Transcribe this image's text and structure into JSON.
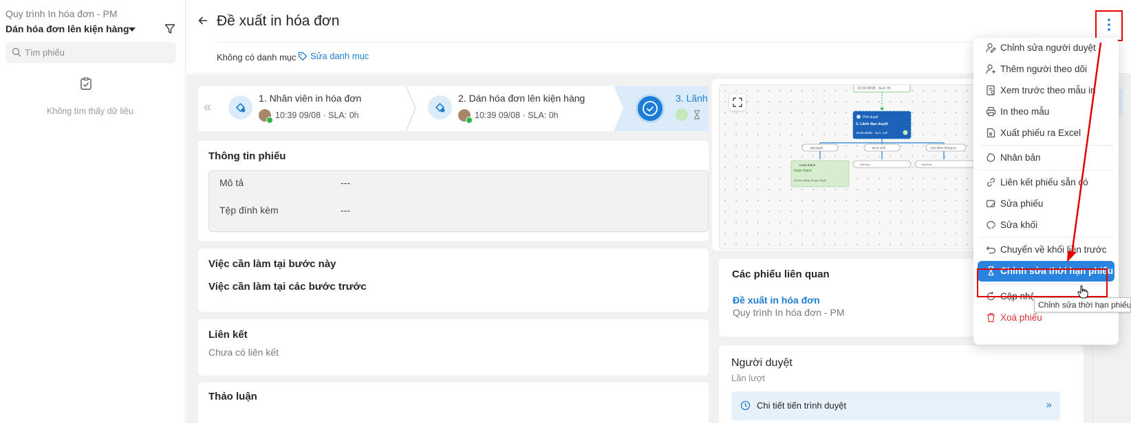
{
  "sidebar": {
    "breadcrumb": "Quy trình In hóa đơn - PM",
    "title": "Dán hóa đơn lên kiện hàng",
    "search_placeholder": "Tìm phiếu",
    "empty_text": "Không tìm thấy dữ liệu"
  },
  "header": {
    "title": "Đề xuất in hóa đơn",
    "category_none": "Không có danh mục",
    "category_edit": "Sửa danh mục"
  },
  "steps": [
    {
      "name": "1. Nhân viên in hóa đơn",
      "meta": "10:39 09/08 · SLA: 0h",
      "icon": "process-icon"
    },
    {
      "name": "2. Dán hóa đơn lên kiện hàng",
      "meta": "10:39 09/08 · SLA: 0h",
      "icon": "process-icon"
    },
    {
      "name": "3. Lãnh",
      "icon": "check-circle-icon"
    }
  ],
  "info": {
    "title": "Thông tin phiếu",
    "desc_label": "Mô tả",
    "desc_value": "---",
    "attach_label": "Tệp đính kèm",
    "attach_value": "---"
  },
  "todo": {
    "current": "Việc cần làm tại bước này",
    "previous": "Việc cần làm tại các bước trước"
  },
  "links": {
    "title": "Liên kết",
    "empty": "Chưa có liên kết"
  },
  "discussion": {
    "title": "Thảo luận"
  },
  "related": {
    "title": "Các phiếu liên quan",
    "link": "Đề xuất in hóa đơn",
    "sub": "Quy trình In hóa đơn - PM"
  },
  "approver": {
    "title": "Người duyệt",
    "mode": "Lần lượt",
    "progress_label": "Chi tiết tiến trình duyệt",
    "more": "»"
  },
  "menu": {
    "items": [
      {
        "label": "Chỉnh sửa người duyệt",
        "icon": "user-edit-icon"
      },
      {
        "label": "Thêm người theo dõi",
        "icon": "user-add-icon"
      },
      {
        "label": "Xem trước theo mẫu in",
        "icon": "preview-doc-icon"
      },
      {
        "label": "In theo mẫu",
        "icon": "printer-icon"
      },
      {
        "label": "Xuất phiếu ra Excel",
        "icon": "excel-export-icon"
      },
      {
        "label": "Nhân bản",
        "icon": "duplicate-icon"
      },
      {
        "label": "Liên kết phiếu sẵn có",
        "icon": "link-icon"
      },
      {
        "label": "Sửa phiếu",
        "icon": "edit-ticket-icon"
      },
      {
        "label": "Sửa khối",
        "icon": "edit-block-icon"
      },
      {
        "label": "Chuyển về khối liền trước",
        "icon": "undo-icon"
      },
      {
        "label": "Chỉnh sửa thời hạn phiếu",
        "icon": "hourglass-icon",
        "active": true
      },
      {
        "label": "Cập nhật",
        "icon": "refresh-icon"
      },
      {
        "label": "Xoá phiếu",
        "icon": "trash-icon",
        "danger": true
      }
    ],
    "tooltip": "Chỉnh sửa thời hạn phiếu"
  },
  "flow_thumbnail": {
    "box_top": "10:39 09/08 · SLA: 0h",
    "approve_title": "Phê duyệt",
    "approve_name": "3. Lãnh đạo duyệt",
    "approve_meta": "10:39 09/08 · SLA: 12h",
    "branch_ok": "Đã duyệt",
    "branch_reject": "Bị từ chối",
    "branch_nopass": "Cần thêm thông tin",
    "done_title": "Hoàn thành",
    "done_body": "Hoàn thành",
    "done_note": "Kết thúc luồng, kết quả: Duyệt",
    "end1": "Kết thúc",
    "end2": "Kết thúc"
  },
  "colors": {
    "accent": "#1c7ed6",
    "menu_active": "#2a83df",
    "danger": "#e03131",
    "annotation": "#e30000"
  }
}
